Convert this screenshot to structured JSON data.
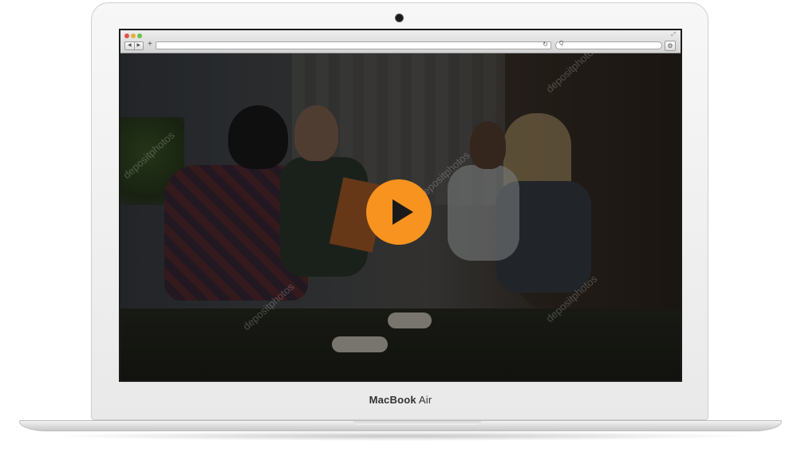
{
  "laptop": {
    "brand_bold": "MacBook",
    "brand_light": "Air"
  },
  "browser": {
    "nav_back": "◀",
    "nav_forward": "▶",
    "add_tab": "+",
    "reload_icon": "reload-icon",
    "search_icon": "search-icon",
    "search_glyph": "Q",
    "gear_icon": "gear-icon"
  },
  "video": {
    "play_button_color": "#f7931e",
    "watermark": "depositphotos"
  }
}
